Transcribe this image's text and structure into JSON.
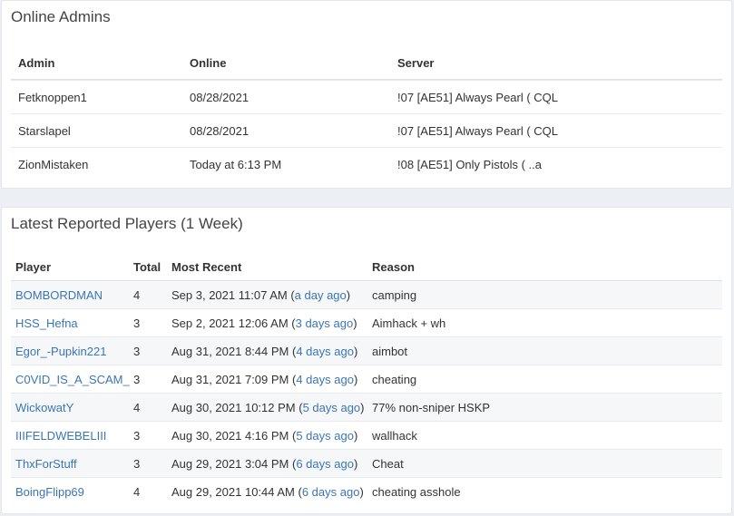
{
  "online_admins": {
    "title": "Online Admins",
    "columns": [
      "Admin",
      "Online",
      "Server"
    ],
    "rows": [
      {
        "admin": "Fetknoppen1",
        "online": "08/28/2021",
        "server": "!07 [AE51] Always Pearl ( CQL"
      },
      {
        "admin": "Starslapel",
        "online": "08/28/2021",
        "server": "!07 [AE51] Always Pearl ( CQL"
      },
      {
        "admin": "ZionMistaken",
        "online": "Today at 6:13 PM",
        "server": "!08 [AE51] Only Pistols ( ..a"
      }
    ]
  },
  "reported_players": {
    "title": "Latest Reported Players (1 Week)",
    "columns": [
      "Player",
      "Total",
      "Most Recent",
      "Reason"
    ],
    "rows": [
      {
        "player": "BOMBORDMAN",
        "total": "4",
        "date": "Sep 3, 2021 11:07 AM",
        "ago": "a day ago",
        "reason": "camping"
      },
      {
        "player": "HSS_Hefna",
        "total": "3",
        "date": "Sep 2, 2021 12:06 AM",
        "ago": "3 days ago",
        "reason": "Aimhack + wh"
      },
      {
        "player": "Egor_-Pupkin221",
        "total": "3",
        "date": "Aug 31, 2021 8:44 PM",
        "ago": "4 days ago",
        "reason": "aimbot"
      },
      {
        "player": "C0VID_IS_A_SCAM_",
        "total": "3",
        "date": "Aug 31, 2021 7:09 PM",
        "ago": "4 days ago",
        "reason": "cheating"
      },
      {
        "player": "WickowatY",
        "total": "4",
        "date": "Aug 30, 2021 10:12 PM",
        "ago": "5 days ago",
        "reason": "77% non-sniper HSKP"
      },
      {
        "player": "IIIFELDWEBELIII",
        "total": "3",
        "date": "Aug 30, 2021 4:16 PM",
        "ago": "5 days ago",
        "reason": "wallhack"
      },
      {
        "player": "ThxForStuff",
        "total": "3",
        "date": "Aug 29, 2021 3:04 PM",
        "ago": "6 days ago",
        "reason": "Cheat"
      },
      {
        "player": "BoingFlipp69",
        "total": "4",
        "date": "Aug 29, 2021 10:44 AM",
        "ago": "6 days ago",
        "reason": "cheating asshole"
      }
    ]
  }
}
